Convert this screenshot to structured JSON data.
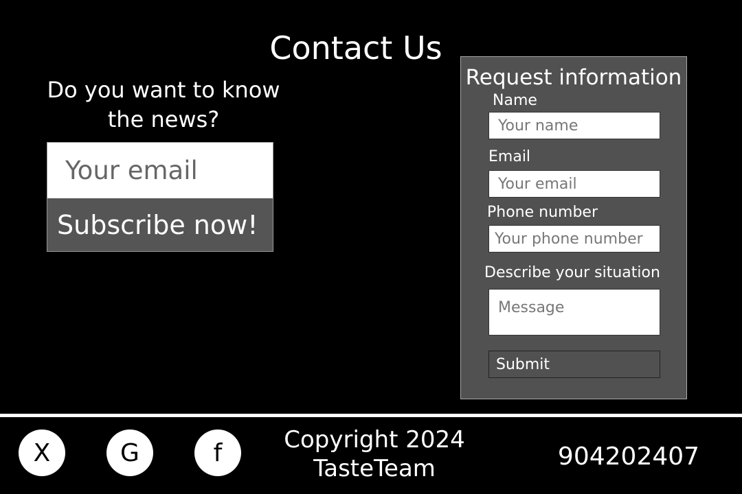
{
  "page": {
    "title": "Contact Us"
  },
  "newsletter": {
    "question": "Do you want to know the news?",
    "email_placeholder": "Your email",
    "subscribe_label": "Subscribe now!"
  },
  "request_form": {
    "title": "Request information",
    "name_label": "Name",
    "name_placeholder": "Your name",
    "email_label": "Email",
    "email_placeholder": "Your email",
    "phone_label": "Phone number",
    "phone_placeholder": "Your phone number",
    "message_label": "Describe your situation",
    "message_placeholder": "Message",
    "submit_label": "Submit"
  },
  "footer": {
    "social": [
      {
        "name": "x-icon",
        "glyph": "X"
      },
      {
        "name": "google-icon",
        "glyph": "G"
      },
      {
        "name": "facebook-icon",
        "glyph": "f"
      }
    ],
    "copyright_line1": "Copyright 2024",
    "copyright_line2": "TasteTeam",
    "phone": "904202407"
  },
  "colors": {
    "background": "#000000",
    "panel": "#515151",
    "button": "#555555",
    "divider": "#ffffff"
  }
}
